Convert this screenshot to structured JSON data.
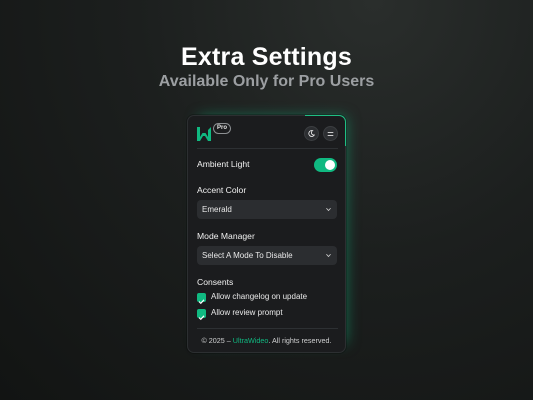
{
  "hero": {
    "title": "Extra Settings",
    "subtitle": "Available Only for Pro Users"
  },
  "panel": {
    "badge": "Pro",
    "logo_icon": "ultrawideo-logo-icon",
    "theme_icon": "moon-icon",
    "menu_icon": "menu-icon",
    "ambient_light": {
      "label": "Ambient Light",
      "enabled": true
    },
    "accent_color": {
      "label": "Accent Color",
      "value": "Emerald"
    },
    "mode_manager": {
      "label": "Mode Manager",
      "value": "Select A Mode To Disable"
    },
    "consents": {
      "label": "Consents",
      "items": [
        {
          "label": "Allow changelog on update",
          "checked": true
        },
        {
          "label": "Allow review prompt",
          "checked": true
        }
      ]
    },
    "footer": {
      "prefix": "© 2025 –",
      "brand": "UltraWideo",
      "suffix": ". All rights reserved."
    }
  },
  "colors": {
    "accent": "#10b981",
    "panel_bg": "#1b1c1e",
    "control_bg": "#2b2d30"
  }
}
